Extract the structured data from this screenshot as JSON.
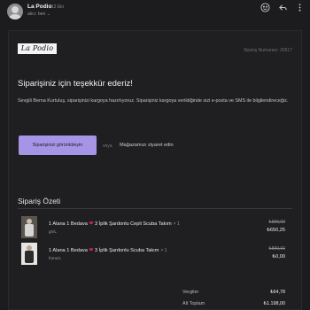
{
  "header": {
    "sender": "La Podio",
    "date": "12 Eki",
    "recipient": "alıcı: ben ⌄",
    "icons": [
      "smiley-icon",
      "reply-icon",
      "more-icon"
    ]
  },
  "email": {
    "brand": "La Podio",
    "order_number": "Sipariş Numarası: 26517",
    "title": "Siparişiniz için teşekkür ederiz!",
    "message": "Sevgili Berna Kurtuluş, siparişinizi kargoya hazırlıyoruz. Siparişiniz kargoya verildiğinde sizi e-posta ve SMS ile bilgilendireceğiz.",
    "cta_label": "Siparişinizi görüntüleyin",
    "or_label": "veya",
    "store_link": "Mağazamızı ziyaret edin",
    "summary_title": "Sipariş Özeti",
    "items": [
      {
        "name_before": "1 Alana 1 Bedava",
        "name_after": "3 İplik Şardonlu Cepli Scuba Takım",
        "quantity": "× 1",
        "variant": "gri/L",
        "old_price": "₺899,00",
        "new_price": "₺650,25"
      },
      {
        "name_before": "1 Alana 1 Bedava",
        "name_after": "3 İplik Şardonlu Scuba Takım",
        "quantity": "× 1",
        "variant": "füme/L",
        "old_price": "₺899,00",
        "new_price": "₺0,00"
      }
    ],
    "totals": [
      {
        "label": "Vergiler",
        "value": "₺64,78"
      },
      {
        "label": "Alt Toplam",
        "value": "₺1.198,00"
      }
    ]
  }
}
